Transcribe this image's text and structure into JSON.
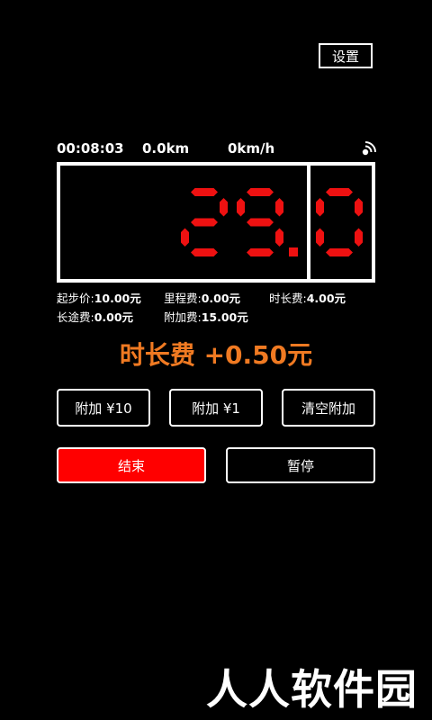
{
  "header": {
    "settings_label": "设置"
  },
  "status": {
    "elapsed_time": "00:08:03",
    "distance": "0.0km",
    "speed": "0km/h",
    "signal_icon": "signal-icon"
  },
  "meter": {
    "integer_part": "29",
    "decimal_part": "0",
    "digit_color": "#ee1111"
  },
  "fees": {
    "base_label": "起步价:",
    "base_value": "10.00元",
    "mileage_label": "里程费:",
    "mileage_value": "0.00元",
    "duration_label": "时长费:",
    "duration_value": "4.00元",
    "long_distance_label": "长途费:",
    "long_distance_value": "0.00元",
    "surcharge_label": "附加费:",
    "surcharge_value": "15.00元"
  },
  "live_fee": {
    "text": "时长费 +0.50元",
    "color": "#f07a22"
  },
  "buttons": {
    "add10": "附加 ¥10",
    "add1": "附加 ¥1",
    "clear": "清空附加",
    "end": "结束",
    "pause": "暂停"
  },
  "watermark": "人人软件园"
}
